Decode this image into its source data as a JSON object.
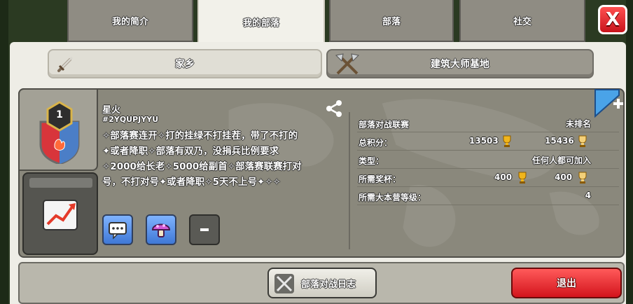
{
  "tabs": [
    {
      "label": "我的简介"
    },
    {
      "label": "我的部落"
    },
    {
      "label": "部落"
    },
    {
      "label": "社交"
    }
  ],
  "close_label": "X",
  "subtabs": [
    {
      "label": "家乡",
      "icon": "sword-icon"
    },
    {
      "label": "建筑大师基地",
      "icon": "crossed-axes-icon"
    }
  ],
  "clan": {
    "level": "1",
    "name": "星火",
    "tag": "#2YQUPJYYU",
    "description": "✧部落赛连开✧打的挂绿不打挂茬，带了不打的\n✦或者降职✧部落有双乃，没捐兵比例要求\n✧2000给长老✧5000给副首✧部落赛联赛打对\n号，不打对号✦或者降职✧5天不上号✦✧✧"
  },
  "info": {
    "war_league_label": "部落对战联赛",
    "war_league_value": "未排名",
    "points_label": "总积分：",
    "points_home": "13503",
    "points_builder": "15436",
    "type_label": "类型：",
    "type_value": "任何人都可加入",
    "required_trophies_label": "所需奖杯：",
    "required_trophies_home": "400",
    "required_trophies_builder": "400",
    "required_th_label": "所需大本营等级：",
    "required_th_value": "4"
  },
  "buttons": {
    "war_log": "部落对战日志",
    "leave": "退出"
  },
  "colors": {
    "accent_red": "#d3141c",
    "trophy_gold": "#f0b51c",
    "panel_bg": "#eeede6"
  }
}
